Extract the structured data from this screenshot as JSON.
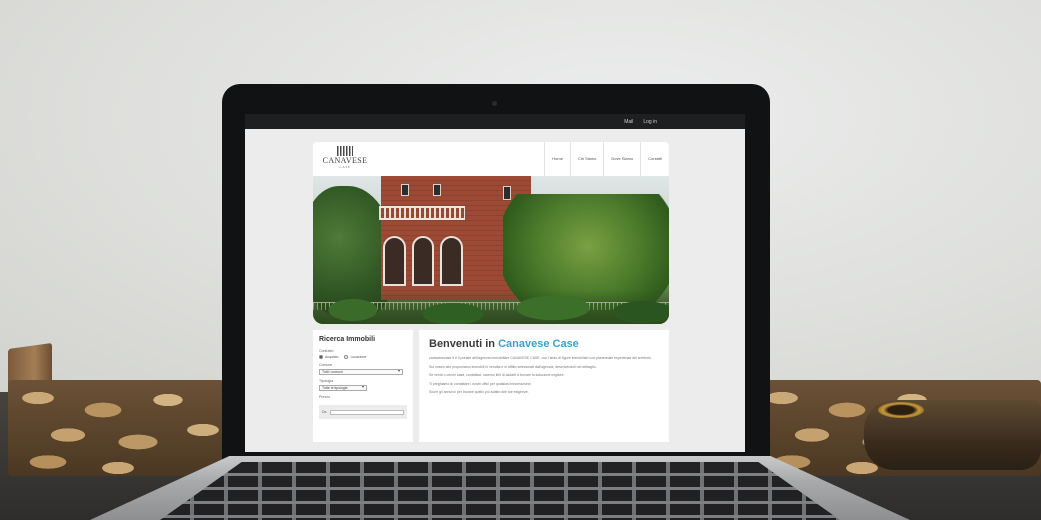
{
  "topbar": {
    "links": [
      "Mail",
      "Log in"
    ]
  },
  "site": {
    "logo": {
      "name": "CANAVESE",
      "sub": "CASE"
    },
    "nav": [
      "Home",
      "Chi Siamo",
      "Dove Siamo",
      "Contatti"
    ],
    "search": {
      "title": "Ricerca Immobili",
      "contract_label": "Contratto",
      "contract_options": [
        "Acquisto",
        "Locazione"
      ],
      "municipality_label": "Comune",
      "municipality_value": "Tutti i comuni",
      "type_label": "Tipologia",
      "type_value": "Tutte le tipologie",
      "price_label": "Prezzo",
      "price_min_label": "Da"
    },
    "welcome": {
      "prefix": "Benvenuti in",
      "brand": "Canavese Case"
    },
    "paragraphs": [
      "canavesecase.it è il portale dell'agenzia immobiliare CANAVESE CASE, con l'aiuto di figure immobiliari con pluriennale esperienza del territorio.",
      "Sul nostro sito proponiamo immobili in vendita e in affitto selezionati dall'agenzia, descrivendoli nel dettaglio.",
      "Se vendi o cerchi casa, contattaci: saremo lieti di aiutarti a trovare la soluzione migliore.",
      "Ti preghiamo di contattare i nostri uffici per qualsiasi informazione.",
      "Scorri gli annunci per trovare quello più adatto alle tue esigenze."
    ]
  },
  "colors": {
    "brand_blue": "#3aa1d6",
    "topbar": "#1e1f20"
  }
}
